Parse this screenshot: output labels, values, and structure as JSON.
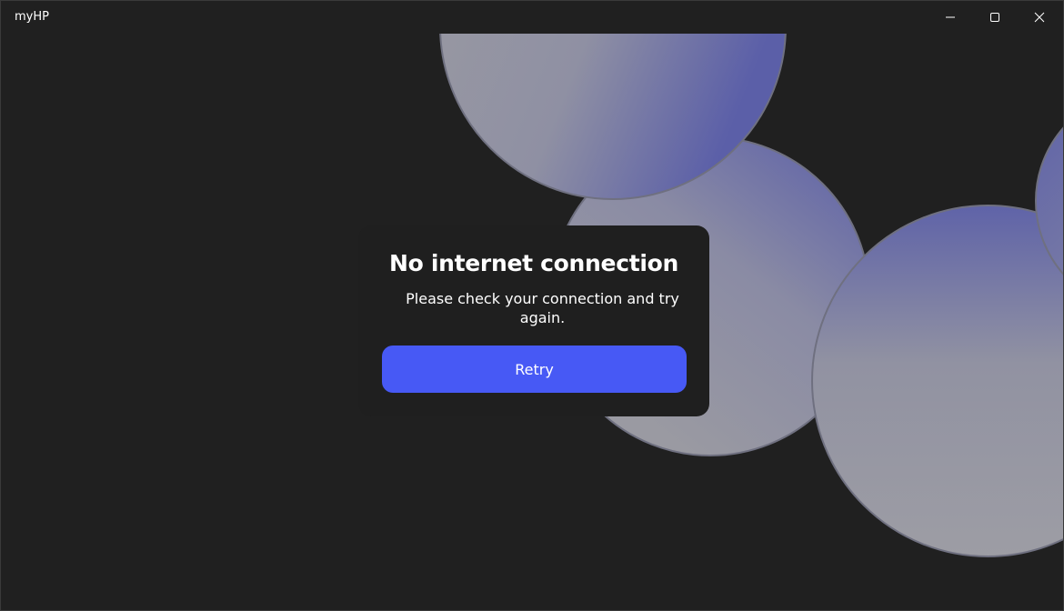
{
  "window": {
    "title": "myHP",
    "controls": {
      "minimize_icon": "minimize-icon",
      "maximize_icon": "maximize-icon",
      "close_icon": "close-icon"
    }
  },
  "dialog": {
    "title": "No internet connection",
    "message": "Please check your connection and try again.",
    "retry_label": "Retry"
  },
  "colors": {
    "background": "#202020",
    "dialog_background": "#1f1f1f",
    "accent": "#4759f5",
    "circle_gray": "#9a9aa3",
    "circle_blue": "#5c60a6"
  }
}
